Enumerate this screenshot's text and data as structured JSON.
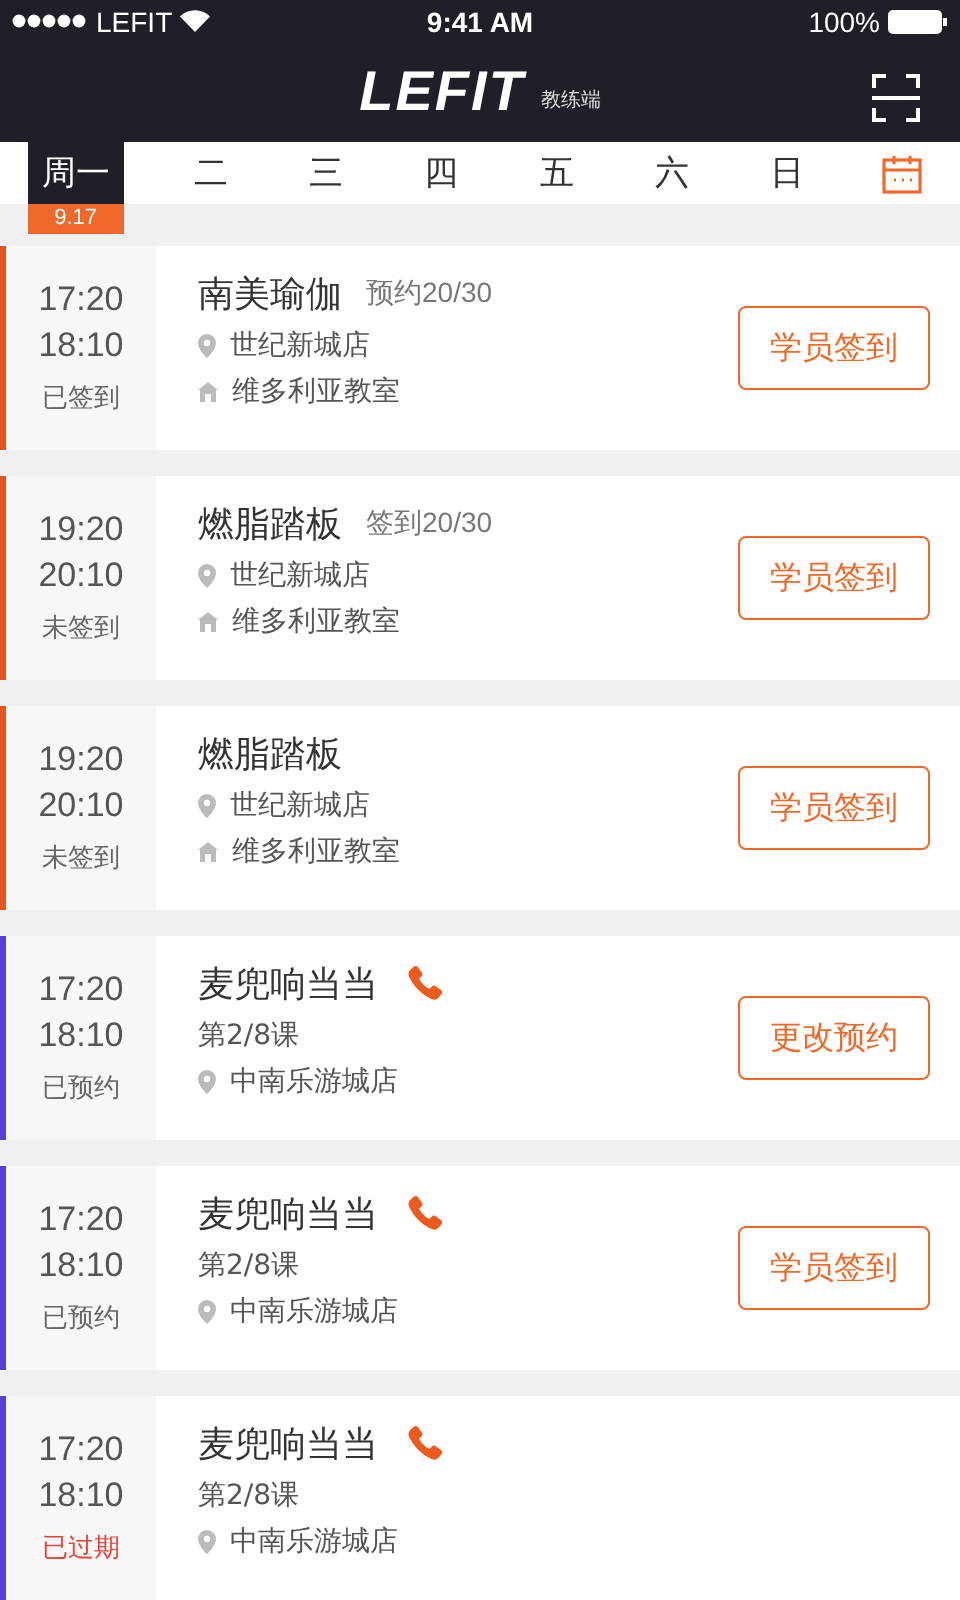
{
  "status_bar": {
    "carrier": "LEFIT",
    "time": "9:41 AM",
    "battery": "100%"
  },
  "header": {
    "logo": "LEFIT",
    "subtitle": "教练端"
  },
  "days": [
    {
      "label": "周一",
      "selected": true,
      "date": "9.17"
    },
    {
      "label": "二",
      "selected": false
    },
    {
      "label": "三",
      "selected": false
    },
    {
      "label": "四",
      "selected": false
    },
    {
      "label": "五",
      "selected": false
    },
    {
      "label": "六",
      "selected": false
    },
    {
      "label": "日",
      "selected": false
    }
  ],
  "sessions": [
    {
      "kind": "class",
      "start": "17:20",
      "end": "18:10",
      "status": "已签到",
      "expired": false,
      "title": "南美瑜伽",
      "count": "预约20/30",
      "store": "世纪新城店",
      "room": "维多利亚教室",
      "button": "学员签到"
    },
    {
      "kind": "class",
      "start": "19:20",
      "end": "20:10",
      "status": "未签到",
      "expired": false,
      "title": "燃脂踏板",
      "count": "签到20/30",
      "store": "世纪新城店",
      "room": "维多利亚教室",
      "button": "学员签到"
    },
    {
      "kind": "class",
      "start": "19:20",
      "end": "20:10",
      "status": "未签到",
      "expired": false,
      "title": "燃脂踏板",
      "store": "世纪新城店",
      "room": "维多利亚教室",
      "button": "学员签到"
    },
    {
      "kind": "booking",
      "start": "17:20",
      "end": "18:10",
      "status": "已预约",
      "expired": false,
      "title": "麦兜响当当",
      "lesson": "第2/8课",
      "store": "中南乐游城店",
      "button": "更改预约"
    },
    {
      "kind": "booking",
      "start": "17:20",
      "end": "18:10",
      "status": "已预约",
      "expired": false,
      "title": "麦兜响当当",
      "lesson": "第2/8课",
      "store": "中南乐游城店",
      "button": "学员签到"
    },
    {
      "kind": "booking",
      "start": "17:20",
      "end": "18:10",
      "status": "已过期",
      "expired": true,
      "title": "麦兜响当当",
      "lesson": "第2/8课",
      "store": "中南乐游城店"
    }
  ]
}
